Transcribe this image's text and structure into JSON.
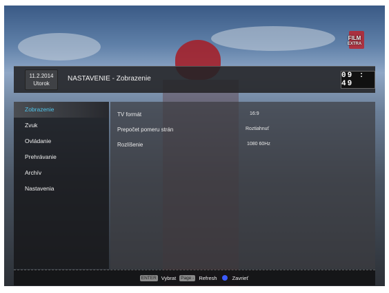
{
  "channel_logo": {
    "line1": "FILM",
    "line2": "EXTRA"
  },
  "header": {
    "date": "11.2.2014",
    "day": "Utorok",
    "title": "NASTAVENIE - Zobrazenie",
    "clock": "09 : 49"
  },
  "sidebar": {
    "items": [
      {
        "label": "Zobrazenie",
        "selected": true
      },
      {
        "label": "Zvuk",
        "selected": false
      },
      {
        "label": "Ovládanie",
        "selected": false
      },
      {
        "label": "Prehrávanie",
        "selected": false
      },
      {
        "label": "Archív",
        "selected": false
      },
      {
        "label": "Nastavenia",
        "selected": false
      }
    ]
  },
  "settings": [
    {
      "label": "TV formát",
      "value": "16:9"
    },
    {
      "label": "Prepočet pomeru strán",
      "value": "Roztiahnuť"
    },
    {
      "label": "Rozlíšenie",
      "value": "1080 60Hz"
    }
  ],
  "footer": {
    "enter_key": "ENTER",
    "enter_action": "Vybrat",
    "page_key": "Page -",
    "page_action": "Refresh",
    "close_action": "Zavrieť"
  },
  "colors": {
    "selected_text": "#4fc3ea",
    "close_button": "#3b5bff",
    "channel_logo_box": "#b8252f"
  }
}
